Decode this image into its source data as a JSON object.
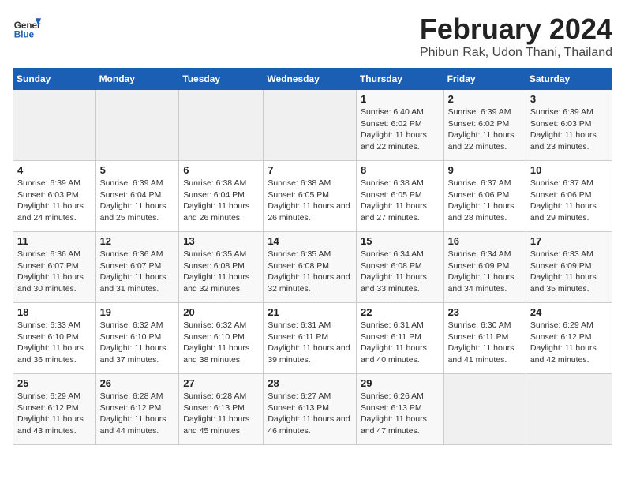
{
  "logo": {
    "general": "General",
    "blue": "Blue"
  },
  "title": "February 2024",
  "location": "Phibun Rak, Udon Thani, Thailand",
  "weekdays": [
    "Sunday",
    "Monday",
    "Tuesday",
    "Wednesday",
    "Thursday",
    "Friday",
    "Saturday"
  ],
  "weeks": [
    [
      {
        "day": "",
        "sunrise": "",
        "sunset": "",
        "daylight": ""
      },
      {
        "day": "",
        "sunrise": "",
        "sunset": "",
        "daylight": ""
      },
      {
        "day": "",
        "sunrise": "",
        "sunset": "",
        "daylight": ""
      },
      {
        "day": "",
        "sunrise": "",
        "sunset": "",
        "daylight": ""
      },
      {
        "day": "1",
        "sunrise": "Sunrise: 6:40 AM",
        "sunset": "Sunset: 6:02 PM",
        "daylight": "Daylight: 11 hours and 22 minutes."
      },
      {
        "day": "2",
        "sunrise": "Sunrise: 6:39 AM",
        "sunset": "Sunset: 6:02 PM",
        "daylight": "Daylight: 11 hours and 22 minutes."
      },
      {
        "day": "3",
        "sunrise": "Sunrise: 6:39 AM",
        "sunset": "Sunset: 6:03 PM",
        "daylight": "Daylight: 11 hours and 23 minutes."
      }
    ],
    [
      {
        "day": "4",
        "sunrise": "Sunrise: 6:39 AM",
        "sunset": "Sunset: 6:03 PM",
        "daylight": "Daylight: 11 hours and 24 minutes."
      },
      {
        "day": "5",
        "sunrise": "Sunrise: 6:39 AM",
        "sunset": "Sunset: 6:04 PM",
        "daylight": "Daylight: 11 hours and 25 minutes."
      },
      {
        "day": "6",
        "sunrise": "Sunrise: 6:38 AM",
        "sunset": "Sunset: 6:04 PM",
        "daylight": "Daylight: 11 hours and 26 minutes."
      },
      {
        "day": "7",
        "sunrise": "Sunrise: 6:38 AM",
        "sunset": "Sunset: 6:05 PM",
        "daylight": "Daylight: 11 hours and 26 minutes."
      },
      {
        "day": "8",
        "sunrise": "Sunrise: 6:38 AM",
        "sunset": "Sunset: 6:05 PM",
        "daylight": "Daylight: 11 hours and 27 minutes."
      },
      {
        "day": "9",
        "sunrise": "Sunrise: 6:37 AM",
        "sunset": "Sunset: 6:06 PM",
        "daylight": "Daylight: 11 hours and 28 minutes."
      },
      {
        "day": "10",
        "sunrise": "Sunrise: 6:37 AM",
        "sunset": "Sunset: 6:06 PM",
        "daylight": "Daylight: 11 hours and 29 minutes."
      }
    ],
    [
      {
        "day": "11",
        "sunrise": "Sunrise: 6:36 AM",
        "sunset": "Sunset: 6:07 PM",
        "daylight": "Daylight: 11 hours and 30 minutes."
      },
      {
        "day": "12",
        "sunrise": "Sunrise: 6:36 AM",
        "sunset": "Sunset: 6:07 PM",
        "daylight": "Daylight: 11 hours and 31 minutes."
      },
      {
        "day": "13",
        "sunrise": "Sunrise: 6:35 AM",
        "sunset": "Sunset: 6:08 PM",
        "daylight": "Daylight: 11 hours and 32 minutes."
      },
      {
        "day": "14",
        "sunrise": "Sunrise: 6:35 AM",
        "sunset": "Sunset: 6:08 PM",
        "daylight": "Daylight: 11 hours and 32 minutes."
      },
      {
        "day": "15",
        "sunrise": "Sunrise: 6:34 AM",
        "sunset": "Sunset: 6:08 PM",
        "daylight": "Daylight: 11 hours and 33 minutes."
      },
      {
        "day": "16",
        "sunrise": "Sunrise: 6:34 AM",
        "sunset": "Sunset: 6:09 PM",
        "daylight": "Daylight: 11 hours and 34 minutes."
      },
      {
        "day": "17",
        "sunrise": "Sunrise: 6:33 AM",
        "sunset": "Sunset: 6:09 PM",
        "daylight": "Daylight: 11 hours and 35 minutes."
      }
    ],
    [
      {
        "day": "18",
        "sunrise": "Sunrise: 6:33 AM",
        "sunset": "Sunset: 6:10 PM",
        "daylight": "Daylight: 11 hours and 36 minutes."
      },
      {
        "day": "19",
        "sunrise": "Sunrise: 6:32 AM",
        "sunset": "Sunset: 6:10 PM",
        "daylight": "Daylight: 11 hours and 37 minutes."
      },
      {
        "day": "20",
        "sunrise": "Sunrise: 6:32 AM",
        "sunset": "Sunset: 6:10 PM",
        "daylight": "Daylight: 11 hours and 38 minutes."
      },
      {
        "day": "21",
        "sunrise": "Sunrise: 6:31 AM",
        "sunset": "Sunset: 6:11 PM",
        "daylight": "Daylight: 11 hours and 39 minutes."
      },
      {
        "day": "22",
        "sunrise": "Sunrise: 6:31 AM",
        "sunset": "Sunset: 6:11 PM",
        "daylight": "Daylight: 11 hours and 40 minutes."
      },
      {
        "day": "23",
        "sunrise": "Sunrise: 6:30 AM",
        "sunset": "Sunset: 6:11 PM",
        "daylight": "Daylight: 11 hours and 41 minutes."
      },
      {
        "day": "24",
        "sunrise": "Sunrise: 6:29 AM",
        "sunset": "Sunset: 6:12 PM",
        "daylight": "Daylight: 11 hours and 42 minutes."
      }
    ],
    [
      {
        "day": "25",
        "sunrise": "Sunrise: 6:29 AM",
        "sunset": "Sunset: 6:12 PM",
        "daylight": "Daylight: 11 hours and 43 minutes."
      },
      {
        "day": "26",
        "sunrise": "Sunrise: 6:28 AM",
        "sunset": "Sunset: 6:12 PM",
        "daylight": "Daylight: 11 hours and 44 minutes."
      },
      {
        "day": "27",
        "sunrise": "Sunrise: 6:28 AM",
        "sunset": "Sunset: 6:13 PM",
        "daylight": "Daylight: 11 hours and 45 minutes."
      },
      {
        "day": "28",
        "sunrise": "Sunrise: 6:27 AM",
        "sunset": "Sunset: 6:13 PM",
        "daylight": "Daylight: 11 hours and 46 minutes."
      },
      {
        "day": "29",
        "sunrise": "Sunrise: 6:26 AM",
        "sunset": "Sunset: 6:13 PM",
        "daylight": "Daylight: 11 hours and 47 minutes."
      },
      {
        "day": "",
        "sunrise": "",
        "sunset": "",
        "daylight": ""
      },
      {
        "day": "",
        "sunrise": "",
        "sunset": "",
        "daylight": ""
      }
    ]
  ]
}
